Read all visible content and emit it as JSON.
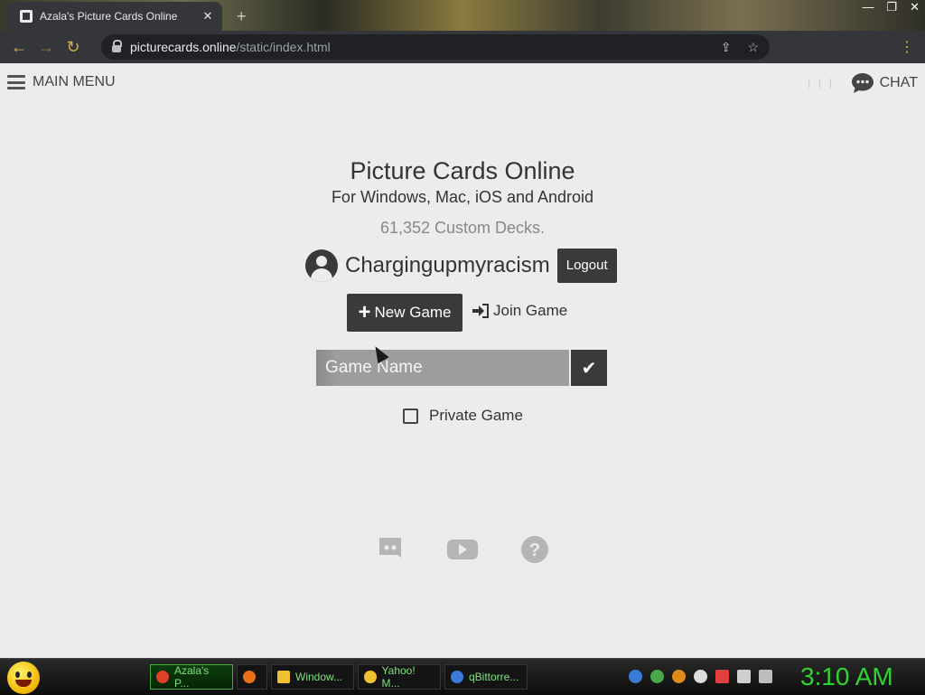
{
  "browser": {
    "tab_title": "Azala's Picture Cards Online",
    "tab_close": "✕",
    "new_tab": "+",
    "url_host": "picturecards.online",
    "url_path": "/static/index.html",
    "win_controls": [
      "—",
      "❐",
      "✕"
    ]
  },
  "header": {
    "main_menu_label": "MAIN MENU",
    "chat_label": "CHAT",
    "indicator": "| | |"
  },
  "main": {
    "title": "Picture Cards Online",
    "subtitle": "For Windows, Mac, iOS and Android",
    "deck_count": "61,352 Custom Decks.",
    "username": "Chargingupmyracism",
    "logout_label": "Logout",
    "new_game_label": "New Game",
    "join_game_label": "Join Game",
    "game_name_placeholder": "Game Name",
    "private_game_label": "Private Game"
  },
  "footer_icons": [
    "discord-icon",
    "youtube-icon",
    "help-icon"
  ],
  "taskbar": {
    "tasks": [
      {
        "label": "Azala's P...",
        "icon_color": "#e0402a"
      },
      {
        "label": "",
        "icon_color": "#e8701a"
      },
      {
        "label": "Window...",
        "icon_color": "#f0c030"
      },
      {
        "label": "Yahoo! M...",
        "icon_color": "#f0c030"
      },
      {
        "label": "qBittorre...",
        "icon_color": "#3a7ad8"
      }
    ],
    "clock": "3:10 AM",
    "clock_color": "#31d231"
  },
  "colors": {
    "button_dark": "#3a3a3a",
    "page_bg": "#ececec",
    "input_bg": "#9d9d9d"
  }
}
